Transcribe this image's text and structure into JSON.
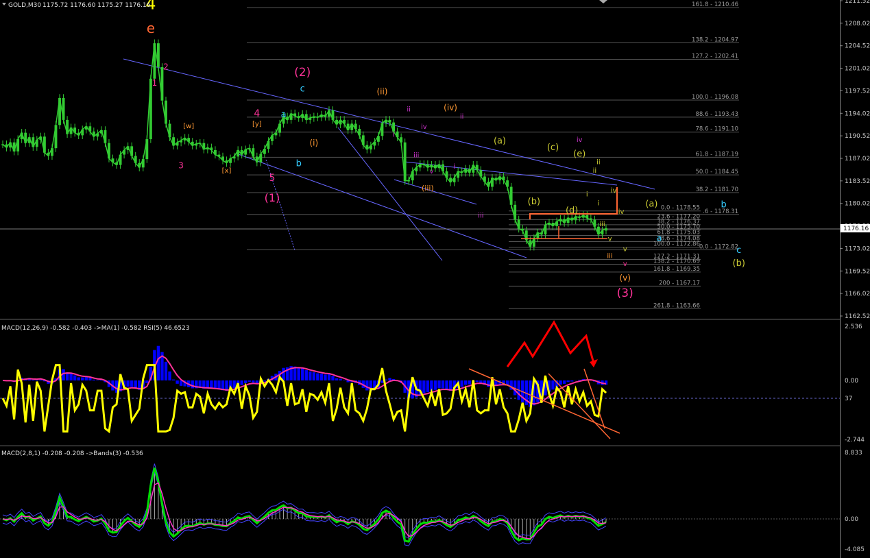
{
  "header": {
    "symbol": "GOLD,M30",
    "ohlc": "1175.72 1176.60 1175.27 1176.16",
    "indicator1": "MACD(12,26,9) -0.582 -0.403  ->MA(1) -0.582  RSI(5) 46.6523",
    "indicator2": "MACD(2,8,1) -0.208 -0.208  ->Bands(3) -0.536"
  },
  "colors": {
    "background": "#000000",
    "candle": "#33cc33",
    "trendline": "#6666ff",
    "fib": "#555555",
    "macd_hist": "#0000ff",
    "rsi": "#ffff00",
    "signal": "#ff3399",
    "annotation_red": "#ff0000",
    "orange": "#ff6633"
  },
  "price_axis": {
    "ticks": [
      "1211.52",
      "1208.02",
      "1204.52",
      "1201.02",
      "1197.52",
      "1194.02",
      "1190.52",
      "1187.02",
      "1183.52",
      "1180.02",
      "1176.52",
      "1173.02",
      "1169.52",
      "1166.02",
      "1162.52"
    ],
    "current_price": "1176.16",
    "range": [
      1162.52,
      1211.52
    ]
  },
  "macd_axis": {
    "ticks": [
      "2.536",
      "0.00",
      "37",
      "-2.744"
    ]
  },
  "macd2_axis": {
    "ticks": [
      "8.833",
      "0.00",
      "-4.085"
    ]
  },
  "fib_levels": [
    {
      "label": "161.8 - 1210.46",
      "price": 1210.46
    },
    {
      "label": "138.2 - 1204.97",
      "price": 1204.97
    },
    {
      "label": "127.2 - 1202.41",
      "price": 1202.41
    },
    {
      "label": "100.0 - 1196.08",
      "price": 1196.08
    },
    {
      "label": "88.6 - 1193.43",
      "price": 1193.43
    },
    {
      "label": "78.6 - 1191.10",
      "price": 1191.1
    },
    {
      "label": "61.8 - 1187.19",
      "price": 1187.19
    },
    {
      "label": "50.0 - 1184.45",
      "price": 1184.45
    },
    {
      "label": "38.2 - 1181.70",
      "price": 1181.7
    },
    {
      "label": ".6 - 1178.31",
      "price": 1178.31
    },
    {
      "label": "0.0 - 1172.82",
      "price": 1172.82
    }
  ],
  "fib_levels_small": [
    {
      "label": "0.0 - 1178.55",
      "price": 1178.85
    },
    {
      "label": "23.6 - 1177.20",
      "price": 1177.5
    },
    {
      "label": "38.2 - 1176.37",
      "price": 1176.7
    },
    {
      "label": "50.0 - 1175.70",
      "price": 1175.9
    },
    {
      "label": "61.8 - 1175.03",
      "price": 1175.03
    },
    {
      "label": "78.6 - 1174.08",
      "price": 1174.08
    },
    {
      "label": "100.0 - 1172.86",
      "price": 1173.2
    },
    {
      "label": "127.2 - 1171.31",
      "price": 1171.31
    },
    {
      "label": "138.2 - 1170.69",
      "price": 1170.55
    },
    {
      "label": "161.8 - 1169.35",
      "price": 1169.35
    },
    {
      "label": "200 - 1167.17",
      "price": 1167.17
    },
    {
      "label": "261.8 - 1163.66",
      "price": 1163.66
    }
  ],
  "chart_data": {
    "type": "line",
    "title": "GOLD,M30",
    "xlabel": "",
    "ylabel": "",
    "ylim": [
      1162.52,
      1211.52
    ],
    "series": [
      {
        "name": "GOLD,M30",
        "values": [
          1189.2,
          1188.7,
          1189.5,
          1188.1,
          1190.0,
          1191.0,
          1189.4,
          1190.3,
          1188.8,
          1189.9,
          1190.4,
          1187.9,
          1187.4,
          1188.6,
          1192.2,
          1196.4,
          1193.0,
          1190.8,
          1191.8,
          1191.0,
          1190.6,
          1191.5,
          1192.0,
          1191.2,
          1190.4,
          1190.9,
          1191.4,
          1189.4,
          1187.0,
          1186.4,
          1186.0,
          1187.6,
          1188.3,
          1188.9,
          1187.4,
          1186.3,
          1185.6,
          1186.9,
          1190.0,
          1199.4,
          1204.9,
          1201.2,
          1196.0,
          1192.4,
          1190.3,
          1189.0,
          1189.5,
          1189.8,
          1190.2,
          1189.6,
          1189.0,
          1189.3,
          1189.4,
          1188.4,
          1188.7,
          1188.3,
          1187.6,
          1187.3,
          1186.7,
          1186.3,
          1187.0,
          1187.3,
          1188.3,
          1187.6,
          1188.4,
          1188.6,
          1187.3,
          1186.4,
          1187.7,
          1188.5,
          1189.7,
          1190.6,
          1191.0,
          1192.4,
          1193.5,
          1193.0,
          1194.0,
          1193.6,
          1193.3,
          1193.9,
          1193.0,
          1193.3,
          1193.5,
          1193.4,
          1193.8,
          1193.5,
          1194.5,
          1193.0,
          1192.3,
          1193.0,
          1192.4,
          1191.4,
          1192.4,
          1191.6,
          1190.6,
          1189.1,
          1188.4,
          1189.0,
          1189.6,
          1190.5,
          1192.5,
          1193.0,
          1192.6,
          1191.2,
          1190.3,
          1189.5,
          1183.5,
          1183.6,
          1185.0,
          1185.6,
          1186.1,
          1186.1,
          1185.6,
          1186.0,
          1185.5,
          1186.1,
          1185.0,
          1184.0,
          1183.3,
          1184.0,
          1185.0,
          1184.8,
          1185.4,
          1184.8,
          1186.0,
          1185.2,
          1184.2,
          1183.4,
          1182.6,
          1184.0,
          1183.6,
          1184.2,
          1183.6,
          1182.6,
          1179.8,
          1177.5,
          1176.1,
          1175.8,
          1174.3,
          1173.3,
          1174.6,
          1175.5,
          1175.2,
          1176.7,
          1177.0,
          1176.5,
          1177.2,
          1177.6,
          1177.0,
          1177.8,
          1177.4,
          1178.0,
          1177.8,
          1178.2,
          1177.7,
          1177.5,
          1176.4,
          1175.2,
          1175.8,
          1176.16
        ]
      }
    ]
  },
  "annotations": [
    {
      "text": "4",
      "color": "#ffff00",
      "size": 24,
      "xi": 39,
      "price": 1210.2
    },
    {
      "text": "e",
      "color": "#ff6633",
      "size": 20,
      "xi": 39,
      "price": 1206.5
    },
    {
      "text": "2",
      "color": "#ff3399",
      "size": 12,
      "xi": 43,
      "price": 1200.8
    },
    {
      "text": "1",
      "color": "#ff3399",
      "size": 12,
      "xi": 40,
      "price": 1198.3
    },
    {
      "text": "[w]",
      "color": "#ff9933",
      "size": 10,
      "xi": 49,
      "price": 1191.7
    },
    {
      "text": "3",
      "color": "#ff3399",
      "size": 12,
      "xi": 47,
      "price": 1185.5
    },
    {
      "text": "[x]",
      "color": "#ff9933",
      "size": 10,
      "xi": 59,
      "price": 1184.8
    },
    {
      "text": "[y]",
      "color": "#ff9933",
      "size": 10,
      "xi": 67,
      "price": 1192.0
    },
    {
      "text": "4",
      "color": "#ff3399",
      "size": 14,
      "xi": 67,
      "price": 1193.5
    },
    {
      "text": "5",
      "color": "#ff3399",
      "size": 14,
      "xi": 71,
      "price": 1183.5
    },
    {
      "text": "(1)",
      "color": "#ff3399",
      "size": 16,
      "xi": 71,
      "price": 1180.3
    },
    {
      "text": "a",
      "color": "#33ccff",
      "size": 13,
      "xi": 74,
      "price": 1193.4
    },
    {
      "text": "b",
      "color": "#33ccff",
      "size": 13,
      "xi": 78,
      "price": 1185.8
    },
    {
      "text": "c",
      "color": "#33ccff",
      "size": 13,
      "xi": 79,
      "price": 1197.4
    },
    {
      "text": "(2)",
      "color": "#ff3399",
      "size": 17,
      "xi": 79,
      "price": 1199.8
    },
    {
      "text": "(i)",
      "color": "#ff9933",
      "size": 12,
      "xi": 82,
      "price": 1189.0
    },
    {
      "text": "(ii)",
      "color": "#ff9933",
      "size": 12,
      "xi": 100,
      "price": 1197.0
    },
    {
      "text": "ii",
      "color": "#cc33cc",
      "size": 10,
      "xi": 107,
      "price": 1194.3
    },
    {
      "text": "i",
      "color": "#cc33cc",
      "size": 10,
      "xi": 103,
      "price": 1190.4
    },
    {
      "text": "iv",
      "color": "#cc33cc",
      "size": 10,
      "xi": 111,
      "price": 1191.6
    },
    {
      "text": "iii",
      "color": "#cc33cc",
      "size": 10,
      "xi": 109,
      "price": 1187.2
    },
    {
      "text": "v",
      "color": "#cc33cc",
      "size": 10,
      "xi": 113,
      "price": 1184.7
    },
    {
      "text": "(iii)",
      "color": "#ff9933",
      "size": 11,
      "xi": 112,
      "price": 1182.0
    },
    {
      "text": "(iv)",
      "color": "#ff9933",
      "size": 12,
      "xi": 118,
      "price": 1194.5
    },
    {
      "text": "ii",
      "color": "#cc33cc",
      "size": 10,
      "xi": 121,
      "price": 1193.2
    },
    {
      "text": "i",
      "color": "#cc33cc",
      "size": 10,
      "xi": 119,
      "price": 1185.4
    },
    {
      "text": "iii",
      "color": "#cc33cc",
      "size": 10,
      "xi": 126,
      "price": 1177.8
    },
    {
      "text": "(a)",
      "color": "#cccc33",
      "size": 13,
      "xi": 131,
      "price": 1189.3
    },
    {
      "text": "(b)",
      "color": "#cccc33",
      "size": 13,
      "xi": 140,
      "price": 1179.9
    },
    {
      "text": "(c)",
      "color": "#cccc33",
      "size": 13,
      "xi": 145,
      "price": 1188.3
    },
    {
      "text": "(d)",
      "color": "#cccc33",
      "size": 13,
      "xi": 150,
      "price": 1178.5
    },
    {
      "text": "(e)",
      "color": "#cccc33",
      "size": 13,
      "xi": 152,
      "price": 1187.3
    },
    {
      "text": "iv",
      "color": "#cc33cc",
      "size": 10,
      "xi": 152,
      "price": 1189.6
    },
    {
      "text": "ii",
      "color": "#cccc33",
      "size": 10,
      "xi": 157,
      "price": 1186.1
    },
    {
      "text": "i",
      "color": "#cccc33",
      "size": 10,
      "xi": 154,
      "price": 1181.1
    },
    {
      "text": "ii",
      "color": "#cccc33",
      "size": 10,
      "xi": 156,
      "price": 1184.8
    },
    {
      "text": "iii",
      "color": "#cccc33",
      "size": 10,
      "xi": 158,
      "price": 1176.5
    },
    {
      "text": "i",
      "color": "#cccc33",
      "size": 10,
      "xi": 157,
      "price": 1179.7
    },
    {
      "text": "iv",
      "color": "#cccc33",
      "size": 10,
      "xi": 161,
      "price": 1181.7
    },
    {
      "text": "iv",
      "color": "#cccc33",
      "size": 10,
      "xi": 163,
      "price": 1178.4
    },
    {
      "text": "v",
      "color": "#cccc33",
      "size": 10,
      "xi": 160,
      "price": 1174.2
    },
    {
      "text": "v",
      "color": "#cccc33",
      "size": 10,
      "xi": 164,
      "price": 1172.6
    },
    {
      "text": "iii",
      "color": "#ff9933",
      "size": 10,
      "xi": 160,
      "price": 1171.5
    },
    {
      "text": "v",
      "color": "#ff3399",
      "size": 10,
      "xi": 164,
      "price": 1170.3
    },
    {
      "text": "(v)",
      "color": "#ff9933",
      "size": 12,
      "xi": 164,
      "price": 1168.0
    },
    {
      "text": "(3)",
      "color": "#ff3399",
      "size": 17,
      "xi": 164,
      "price": 1165.5
    },
    {
      "text": "a",
      "color": "#33ccff",
      "size": 13,
      "xi": 173,
      "price": 1174.2
    },
    {
      "text": "(a)",
      "color": "#cccc33",
      "size": 13,
      "xi": 171,
      "price": 1179.5
    },
    {
      "text": "b",
      "color": "#33ccff",
      "size": 13,
      "xi": 190,
      "price": 1179.4
    },
    {
      "text": "c",
      "color": "#33ccff",
      "size": 13,
      "xi": 194,
      "price": 1172.3
    },
    {
      "text": "(b)",
      "color": "#cccc33",
      "size": 13,
      "xi": 194,
      "price": 1170.3
    }
  ]
}
